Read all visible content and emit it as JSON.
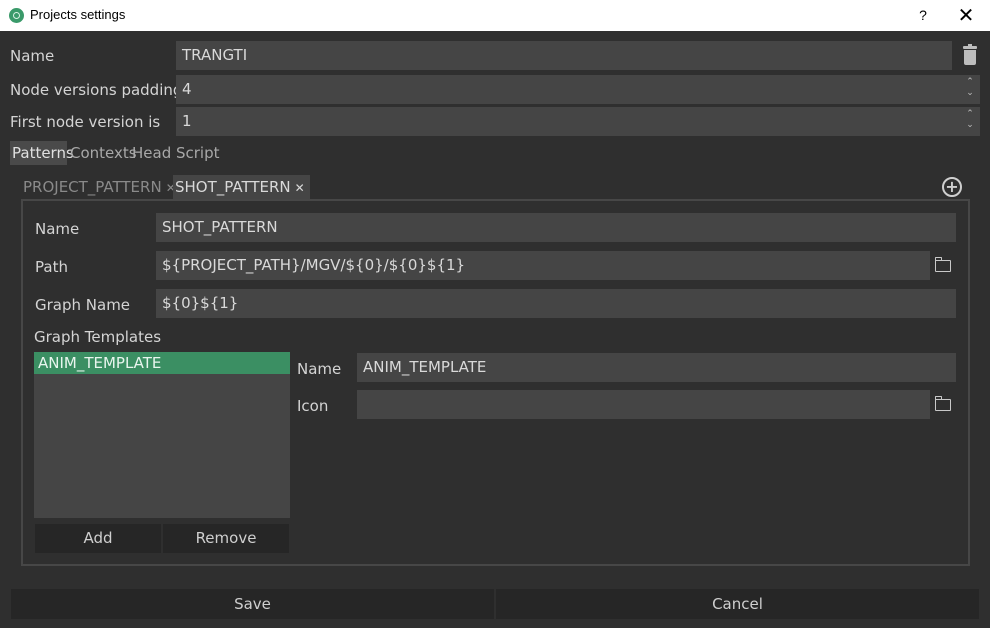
{
  "window": {
    "title": "Projects settings",
    "help": "?",
    "close": "✕"
  },
  "project": {
    "name_label": "Name",
    "name_value": "TRANGTI",
    "padding_label": "Node versions padding",
    "padding_value": "4",
    "first_label": "First node version is",
    "first_value": "1"
  },
  "tabs": [
    "Patterns",
    "Contexts",
    "Head Script"
  ],
  "pattern_tabs": [
    {
      "label": "PROJECT_PATTERN",
      "close": "✕"
    },
    {
      "label": "SHOT_PATTERN",
      "close": "✕"
    }
  ],
  "pattern": {
    "name_label": "Name",
    "name_value": "SHOT_PATTERN",
    "path_label": "Path",
    "path_value": "${PROJECT_PATH}/MGV/${0}/${0}${1}",
    "graph_label": "Graph Name",
    "graph_value": "${0}${1}",
    "templates_label": "Graph Templates",
    "templates": [
      "ANIM_TEMPLATE"
    ],
    "add_label": "Add",
    "remove_label": "Remove"
  },
  "template_detail": {
    "name_label": "Name",
    "name_value": "ANIM_TEMPLATE",
    "icon_label": "Icon",
    "icon_value": ""
  },
  "footer": {
    "save_label": "Save",
    "cancel_label": "Cancel"
  },
  "colors": {
    "accent": "#3b8f63",
    "background": "#2f2f2f",
    "field": "#454545"
  },
  "icons": [
    "app-icon",
    "trash-icon",
    "spin-arrows-icon",
    "add-circle-icon",
    "folder-icon",
    "close-icon"
  ]
}
